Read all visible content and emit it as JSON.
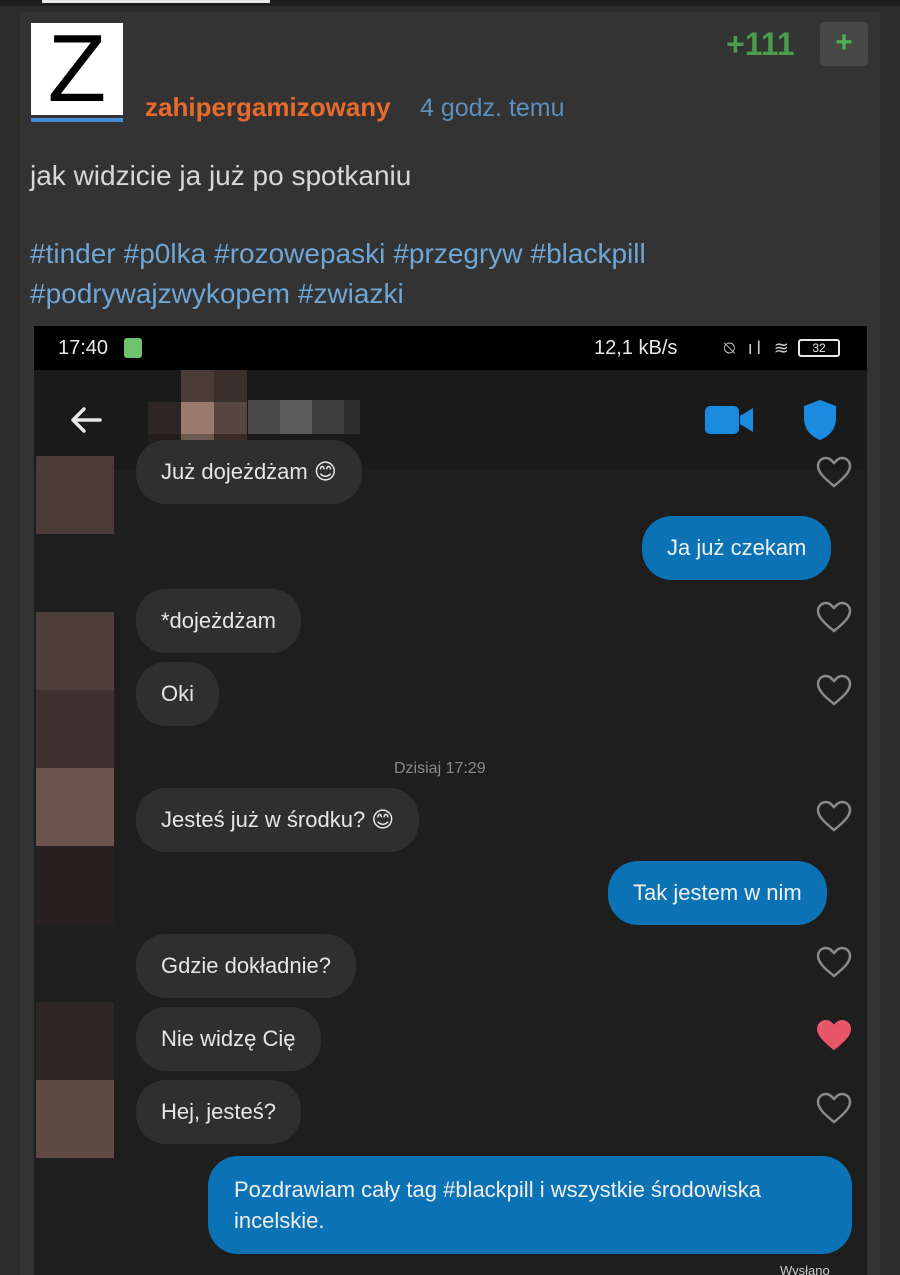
{
  "post": {
    "avatar_letter": "Z",
    "author": "zahipergamizowany",
    "time": "4 godz. temu",
    "votes": "+111",
    "plus_label": "+",
    "text": "jak widzicie ja już po spotkaniu",
    "tags": [
      "#tinder",
      "#p0lka",
      "#rozowepaski",
      "#przegryw",
      "#blackpill",
      "#podrywajzwykopem",
      "#zwiazki"
    ]
  },
  "screenshot": {
    "status": {
      "time": "17:40",
      "speed": "12,1 kB/s",
      "battery": "32"
    },
    "date_separator": "Dzisiaj 17:29",
    "messages": [
      {
        "side": "in",
        "text": "Już dojeżdżam 😊"
      },
      {
        "side": "out",
        "text": "Ja już czekam"
      },
      {
        "side": "in",
        "text": "*dojeżdżam"
      },
      {
        "side": "in",
        "text": "Oki"
      },
      {
        "side": "in",
        "text": "Jesteś już w środku? 😊"
      },
      {
        "side": "out",
        "text": "Tak jestem w nim"
      },
      {
        "side": "in",
        "text": "Gdzie dokładnie?"
      },
      {
        "side": "in",
        "text": "Nie widzę Cię",
        "liked": true
      },
      {
        "side": "in",
        "text": "Hej, jesteś?"
      },
      {
        "side": "out",
        "text": "Pozdrawiam cały tag #blackpill i wszystkie środowiska incelskie."
      }
    ],
    "sent_label": "Wysłano",
    "colors": {
      "incoming": "#2f2f2f",
      "outgoing": "#0b72b5",
      "heart_liked": "#e8566b",
      "shield": "#1a8be0"
    }
  }
}
